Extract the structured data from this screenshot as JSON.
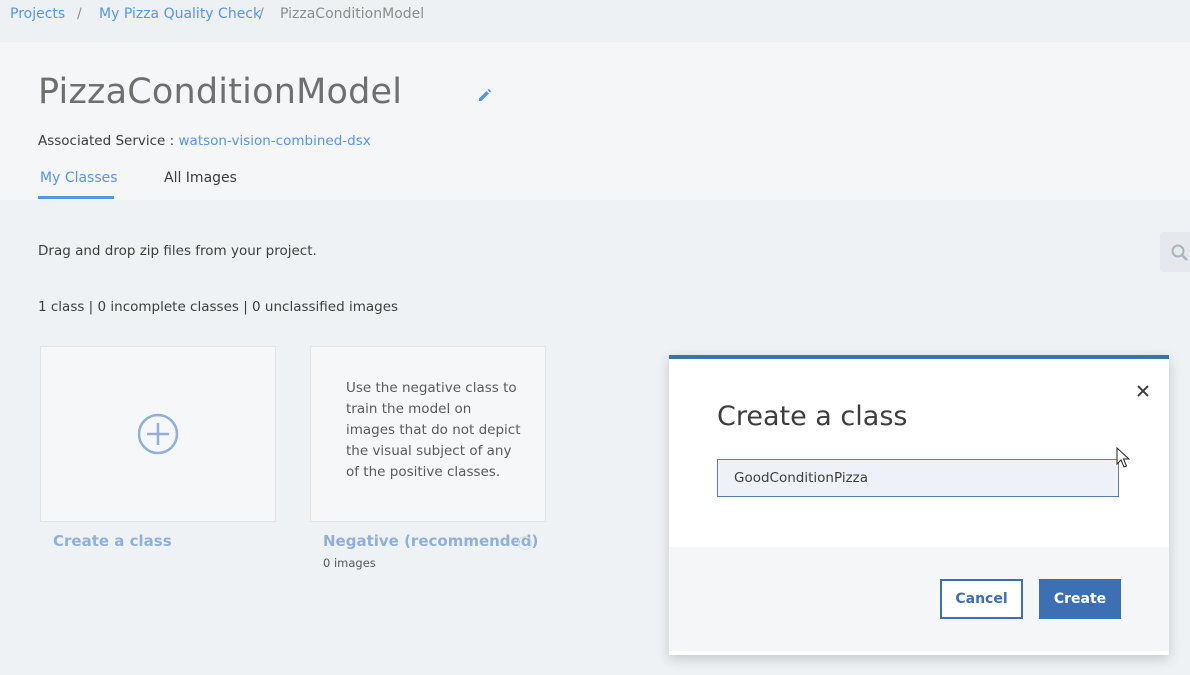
{
  "breadcrumb": {
    "items": [
      "Projects",
      "My Pizza Quality Check",
      "PizzaConditionModel"
    ],
    "separator": "/"
  },
  "page": {
    "title": "PizzaConditionModel",
    "associated_label": "Associated Service :",
    "associated_service": "watson-vision-combined-dsx"
  },
  "tabs": [
    {
      "label": "My Classes",
      "active": true
    },
    {
      "label": "All Images",
      "active": false
    }
  ],
  "content": {
    "drag_hint": "Drag and drop zip files from your project.",
    "counts": "1 class | 0 incomplete classes | 0 unclassified images"
  },
  "cards": {
    "create_label": "Create a class",
    "negative_description": "Use the negative class to train the model on images that do not depict the visual subject of any of the positive classes.",
    "negative_label": "Negative (recommended)",
    "negative_count": "0 images"
  },
  "modal": {
    "title": "Create a class",
    "input_value": "GoodConditionPizza",
    "cancel_label": "Cancel",
    "create_label": "Create"
  },
  "icons": {
    "edit": "pencil-icon",
    "search": "search-icon",
    "add": "plus-circle-icon",
    "close": "close-icon",
    "cursor": "mouse-cursor"
  },
  "colors": {
    "accent": "#5596e6",
    "primary_button": "#3d70b2",
    "background": "#eff2f5"
  }
}
